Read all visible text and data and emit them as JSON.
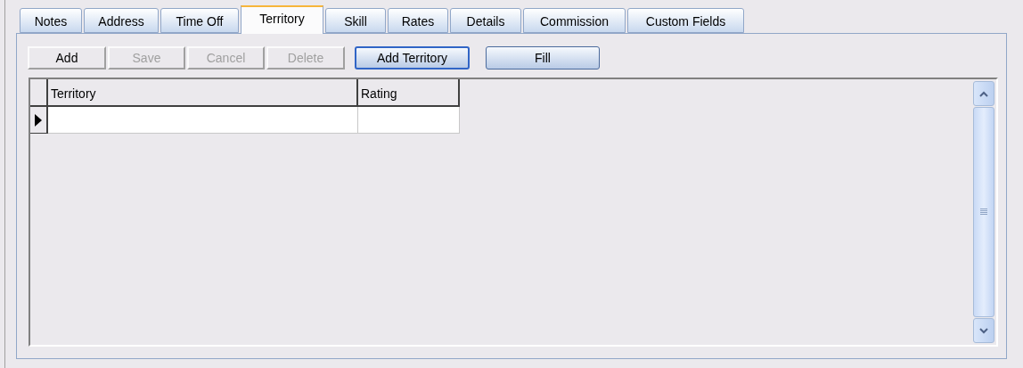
{
  "tabs": [
    {
      "label": "Notes",
      "selected": false
    },
    {
      "label": "Address",
      "selected": false
    },
    {
      "label": "Time Off",
      "selected": false
    },
    {
      "label": "Territory",
      "selected": true
    },
    {
      "label": "Skill",
      "selected": false
    },
    {
      "label": "Rates",
      "selected": false
    },
    {
      "label": "Details",
      "selected": false
    },
    {
      "label": "Commission",
      "selected": false
    },
    {
      "label": "Custom Fields",
      "selected": false
    }
  ],
  "toolbar": [
    {
      "label": "Add",
      "kind": "flat",
      "disabled": false,
      "focused": false
    },
    {
      "label": "Save",
      "kind": "flat",
      "disabled": true,
      "focused": false
    },
    {
      "label": "Cancel",
      "kind": "flat",
      "disabled": true,
      "focused": false
    },
    {
      "label": "Delete",
      "kind": "flat",
      "disabled": true,
      "focused": false
    },
    {
      "label": "Add Territory",
      "kind": "xp",
      "disabled": false,
      "focused": true
    },
    {
      "label": "Fill",
      "kind": "xp",
      "disabled": false,
      "focused": false
    }
  ],
  "grid": {
    "columns": [
      "Territory",
      "Rating"
    ],
    "rows": [
      {
        "current": true
      }
    ]
  }
}
